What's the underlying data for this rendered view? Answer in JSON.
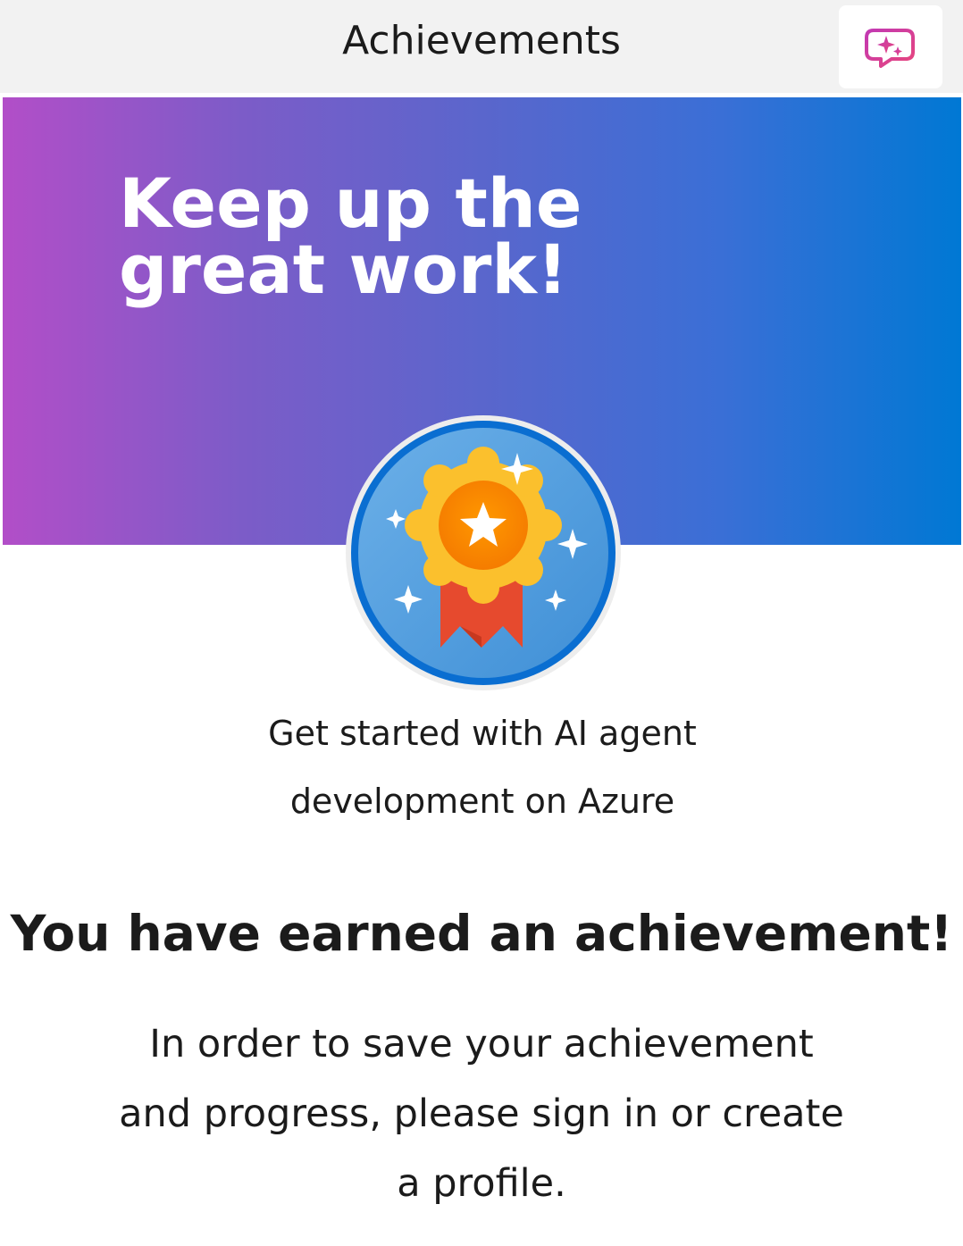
{
  "header": {
    "title": "Achievements",
    "chat_icon": "ai-chat-sparkle-icon"
  },
  "hero": {
    "heading": "Keep up the great work!"
  },
  "badge": {
    "icon": "award-ribbon-icon",
    "colors": {
      "ring": "#0a6ed1",
      "fill": "#5aa2e0",
      "medal": "#fbc02d",
      "ribbon": "#e64a2e"
    }
  },
  "course": {
    "title": "Get started with AI agent development on Azure"
  },
  "achievement": {
    "heading": "You have earned an achievement!",
    "message": "In order to save your achievement and progress, please sign in or create a profile."
  }
}
